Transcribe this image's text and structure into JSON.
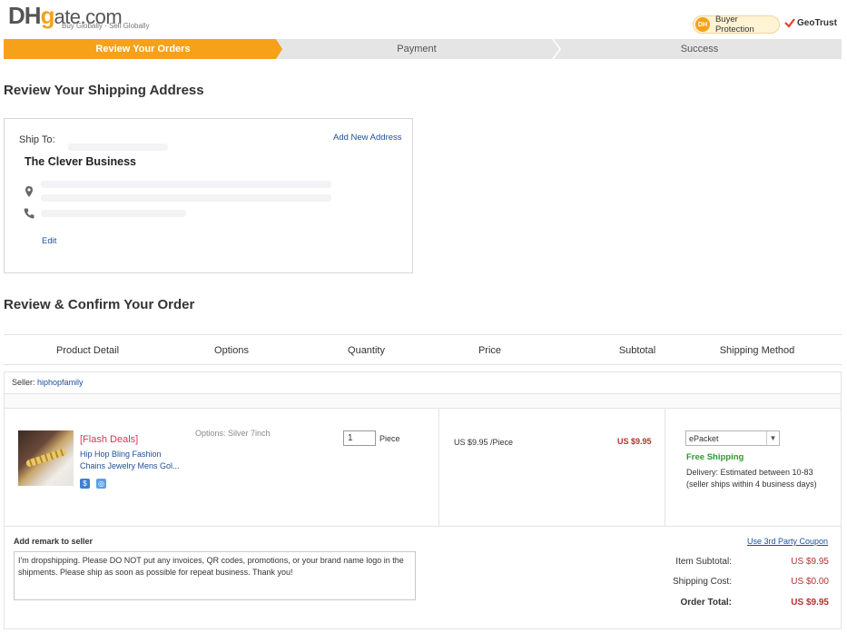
{
  "header": {
    "logo_dh": "DH",
    "logo_g": "g",
    "logo_rest": "ate.com",
    "tagline": "Buy Globally · Sell Globally",
    "buyer_protection": "Buyer Protection",
    "buyer_protection_mark": "DH",
    "geotrust": "GeoTrust"
  },
  "progress": {
    "steps": [
      {
        "label": "Review Your Orders",
        "active": true
      },
      {
        "label": "Payment",
        "active": false
      },
      {
        "label": "Success",
        "active": false
      }
    ]
  },
  "shipping": {
    "heading": "Review Your Shipping Address",
    "ship_to_label": "Ship To:",
    "add_new_address": "Add New Address",
    "name": "The Clever Business",
    "edit": "Edit"
  },
  "order": {
    "heading": "Review & Confirm Your Order",
    "columns": [
      "Product Detail",
      "Options",
      "Quantity",
      "Price",
      "Subtotal",
      "Shipping Method"
    ],
    "seller_label": "Seller:",
    "seller_name": "hiphopfamily",
    "item": {
      "flash": "[Flash Deals]",
      "title": "Hip Hop Bling Fashion Chains Jewelry Mens Gol...",
      "options": "Options:  Silver 7inch",
      "quantity": "1",
      "unit": "Piece",
      "price": "US $9.95 /Piece",
      "subtotal": "US $9.95",
      "shipping_method": "ePacket",
      "free_shipping": "Free Shipping",
      "delivery": "Delivery: Estimated between 10-83 (seller ships within 4 business days)"
    },
    "remark_label": "Add remark to seller",
    "remark_text": "I'm dropshipping. Please DO NOT put any invoices, QR codes, promotions, or your brand name logo in the shipments. Please ship as soon as possible for repeat business. Thank you!",
    "coupon_link": "Use 3rd Party Coupon",
    "summary": {
      "item_subtotal_label": "Item Subtotal:",
      "item_subtotal": "US $9.95",
      "shipping_cost_label": "Shipping Cost:",
      "shipping_cost": "US $0.00",
      "order_total_label": "Order Total:",
      "order_total": "US $9.95"
    }
  },
  "colors": {
    "accent_orange": "#f7a11a",
    "link_blue": "#1b4f9c",
    "price_red": "#b3322a",
    "flash_pink": "#e1325a",
    "free_green": "#2d9a2d"
  }
}
